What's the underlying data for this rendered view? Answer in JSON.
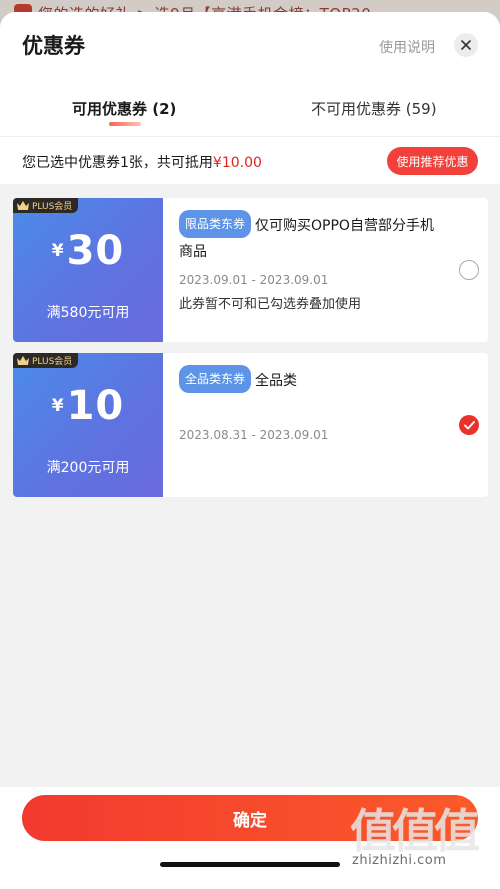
{
  "background": {
    "banner_text": "您的选的好礼 > 选9月【京港手机金榜：TOP20"
  },
  "header": {
    "title": "优惠券",
    "help_label": "使用说明"
  },
  "tabs": [
    {
      "label": "可用优惠券 (2)",
      "active": true
    },
    {
      "label": "不可用优惠券 (59)",
      "active": false
    }
  ],
  "summary": {
    "prefix": "您已选中优惠券1张，共可抵用",
    "amount": "¥10.00",
    "recommend_button": "使用推荐优惠"
  },
  "coupons": [
    {
      "badge": "PLUS会员",
      "currency": "¥",
      "amount": "30",
      "condition": "满580元可用",
      "tag": "限品类东券",
      "description": "仅可购买OPPO自营部分手机商品",
      "validity": "2023.09.01 - 2023.09.01",
      "note": "此券暂不可和已勾选券叠加使用",
      "selected": false
    },
    {
      "badge": "PLUS会员",
      "currency": "¥",
      "amount": "10",
      "condition": "满200元可用",
      "tag": "全品类东券",
      "description": "全品类",
      "validity": "2023.08.31 - 2023.09.01",
      "note": "",
      "selected": true
    }
  ],
  "footer": {
    "confirm_button": "确定"
  },
  "watermark": {
    "glyphs": "值值值",
    "url": "zhizhizhi.com"
  },
  "colors": {
    "accent": "#f2413b",
    "coupon_blue": "#5f72e0",
    "tag_blue": "#5d94e8"
  }
}
